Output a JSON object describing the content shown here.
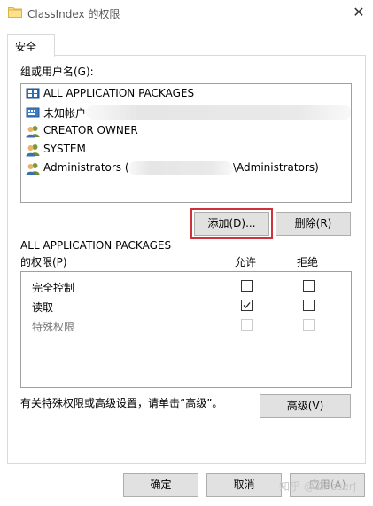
{
  "window": {
    "title": "ClassIndex 的权限",
    "icon": "folder-icon",
    "close_glyph": "✕"
  },
  "tabs": [
    {
      "label": "安全"
    }
  ],
  "users_section": {
    "label": "组或用户名(G):",
    "users": [
      {
        "name": "ALL APPLICATION PACKAGES",
        "icon": "packages-icon",
        "selected": true
      },
      {
        "name": "未知帐户",
        "icon": "unknown-account-icon"
      },
      {
        "name": "CREATOR OWNER",
        "icon": "users-icon"
      },
      {
        "name": "SYSTEM",
        "icon": "users-icon"
      },
      {
        "name": "Administrators (",
        "name_suffix": "\\Administrators)",
        "icon": "users-icon"
      }
    ]
  },
  "buttons": {
    "add": "添加(D)...",
    "remove": "删除(R)",
    "advanced": "高级(V)",
    "ok": "确定",
    "cancel": "取消",
    "apply": "应用(A)"
  },
  "permissions": {
    "principal": "ALL APPLICATION PACKAGES",
    "label": "的权限(P)",
    "allow_header": "允许",
    "deny_header": "拒绝",
    "rows": [
      {
        "name": "完全控制",
        "allow": false,
        "deny": false,
        "disabled": false
      },
      {
        "name": "读取",
        "allow": true,
        "deny": false,
        "disabled": false
      },
      {
        "name": "特殊权限",
        "allow": false,
        "deny": false,
        "disabled": true
      }
    ]
  },
  "advanced_hint": "有关特殊权限或高级设置，请单击“高级”。",
  "watermark": "知乎 @ZinsserJ"
}
